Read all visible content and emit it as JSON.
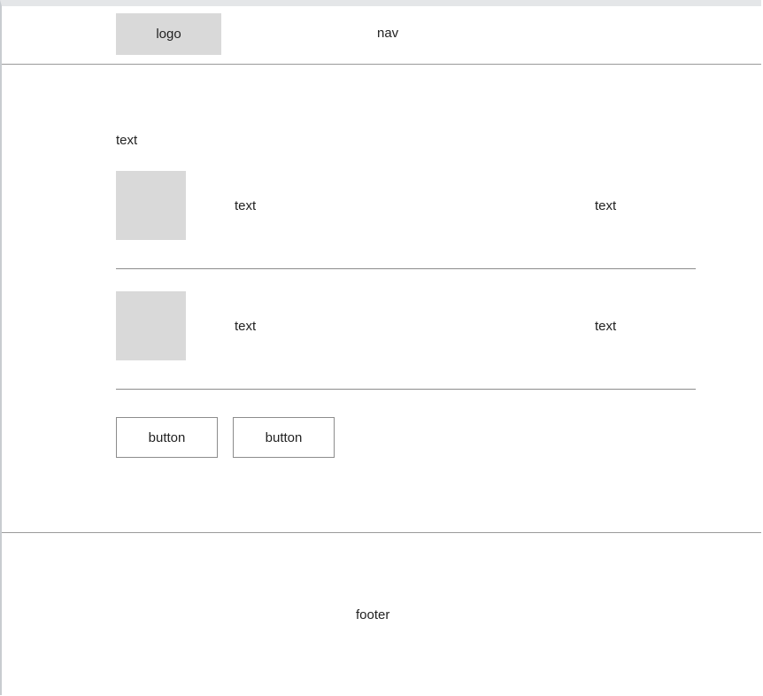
{
  "header": {
    "logo_label": "logo",
    "nav_label": "nav"
  },
  "main": {
    "heading": "text",
    "rows": [
      {
        "text": "text",
        "side_text": "text"
      },
      {
        "text": "text",
        "side_text": "text"
      }
    ],
    "buttons": [
      {
        "label": "button"
      },
      {
        "label": "button"
      }
    ]
  },
  "footer": {
    "label": "footer"
  },
  "colors": {
    "placeholder_fill": "#d9d9d9",
    "divider": "#8c8c8c",
    "text": "#222222"
  }
}
